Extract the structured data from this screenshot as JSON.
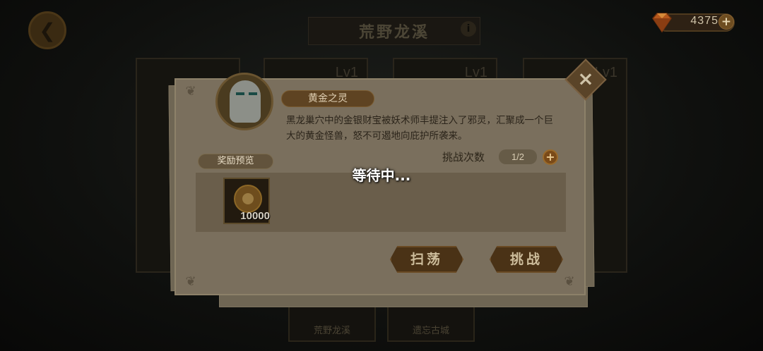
{
  "header": {
    "title": "荒野龙溪",
    "gems": "4375",
    "gems_plus": "+"
  },
  "background": {
    "card_levels": [
      "Lv1",
      "Lv1",
      "Lv1"
    ],
    "bottom_tabs": [
      "荒野龙溪",
      "遗忘古城"
    ]
  },
  "dialog": {
    "boss_name": "黄金之灵",
    "description": "黑龙巢穴中的金银财宝被妖术师丰提注入了邪灵，汇聚成一个巨大的黄金怪兽，怒不可遏地向庇护所袭来。",
    "reward_label": "奖励预览",
    "attempts_label": "挑战次数",
    "attempts_value": "1/2",
    "attempts_plus": "+",
    "reward_items": [
      {
        "icon": "gold-coin-icon",
        "quantity": "10000"
      }
    ],
    "sweep_button": "扫荡",
    "challenge_button": "挑战",
    "close": "×"
  },
  "overlay": {
    "waiting_text": "等待中..."
  },
  "colors": {
    "dim_overlay": "#0b0a08",
    "dialog_bg": "#7a6f5d",
    "button_bg": "#4a3216"
  }
}
